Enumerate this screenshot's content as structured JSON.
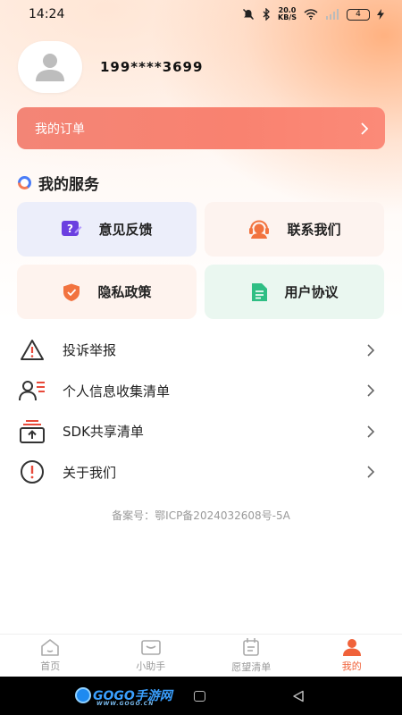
{
  "status_bar": {
    "time": "14:24",
    "speed_value": "20.0",
    "speed_unit": "KB/S",
    "battery": "4"
  },
  "profile": {
    "phone": "199****3699"
  },
  "order": {
    "label": "我的订单"
  },
  "services": {
    "title": "我的服务",
    "cards": [
      {
        "label": "意见反馈",
        "icon": "feedback-icon",
        "color": "#6b3fe0"
      },
      {
        "label": "联系我们",
        "icon": "customer-service-icon",
        "color": "#f2733f"
      },
      {
        "label": "隐私政策",
        "icon": "shield-icon",
        "color": "#f2733f"
      },
      {
        "label": "用户协议",
        "icon": "document-icon",
        "color": "#2fbe84"
      }
    ]
  },
  "menu": [
    {
      "label": "投诉举报",
      "icon": "warning-triangle-icon"
    },
    {
      "label": "个人信息收集清单",
      "icon": "user-list-icon"
    },
    {
      "label": "SDK共享清单",
      "icon": "share-box-icon"
    },
    {
      "label": "关于我们",
      "icon": "info-circle-icon"
    }
  ],
  "icp": "备案号：鄂ICP备2024032608号-5A",
  "tabbar": {
    "tabs": [
      {
        "label": "首页",
        "icon": "home-icon"
      },
      {
        "label": "小助手",
        "icon": "assistant-icon"
      },
      {
        "label": "愿望清单",
        "icon": "wishlist-icon"
      },
      {
        "label": "我的",
        "icon": "profile-icon",
        "active": true
      }
    ]
  },
  "watermark": {
    "brand": "GOGO手游网",
    "domain": "WWW.GOGO.CN"
  },
  "colors": {
    "accent": "#f0623a",
    "order_bar": "#f98270"
  }
}
